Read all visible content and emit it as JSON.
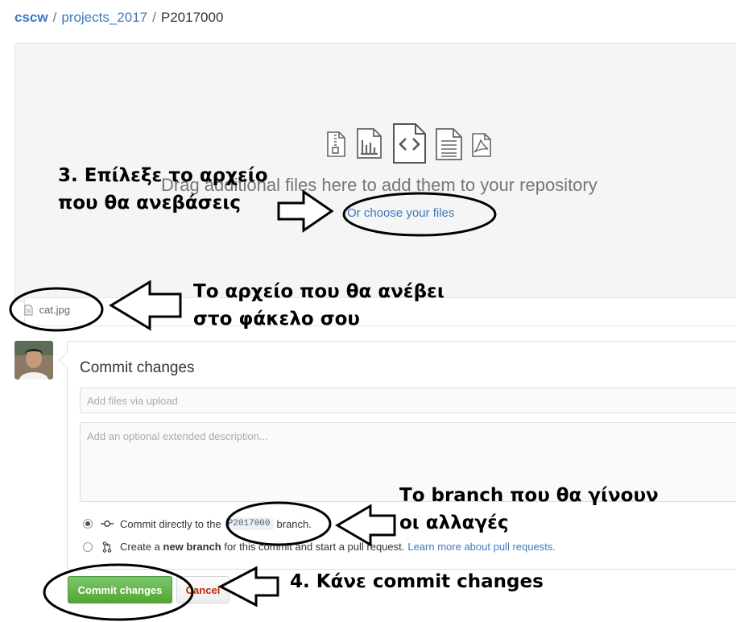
{
  "breadcrumb": {
    "owner": "cscw",
    "repo": "projects_2017",
    "separator": "/",
    "directory": "P2017000"
  },
  "dropzone": {
    "drag_text": "Drag additional files here to add them to your repository",
    "choose_link": "Or choose your files",
    "icons": [
      "zip-file-icon",
      "chart-file-icon",
      "code-file-icon",
      "text-file-icon",
      "pdf-file-icon"
    ]
  },
  "file_list": {
    "files": [
      {
        "name": "cat.jpg",
        "icon": "file-icon"
      }
    ]
  },
  "commit": {
    "title": "Commit changes",
    "summary_placeholder": "Add files via upload",
    "description_placeholder": "Add an optional extended description...",
    "option_direct": {
      "prefix": "Commit directly to the",
      "branch": "P2017000",
      "suffix": "branch."
    },
    "option_new": {
      "prefix": "Create a",
      "bold": "new branch",
      "middle": "for this commit and start a pull request.",
      "link": "Learn more about pull requests."
    },
    "commit_button": "Commit changes",
    "cancel_button": "Cancel"
  },
  "annotations": {
    "choose_file_line1": "3. Επίλεξε το αρχείο",
    "choose_file_line2": "που θα ανεβάσεις",
    "file_line1": "Το αρχείο που θα ανέβει",
    "file_line2": "στο φάκελο σου",
    "branch_line1": "Το branch που θα γίνουν",
    "branch_line2": "οι αλλαγές",
    "commit_line": "4. Κάνε commit changes"
  },
  "colors": {
    "link": "#4078c0",
    "commit_button": "#55a532",
    "cancel_text": "#bd2c00",
    "annotation": "#000000"
  }
}
